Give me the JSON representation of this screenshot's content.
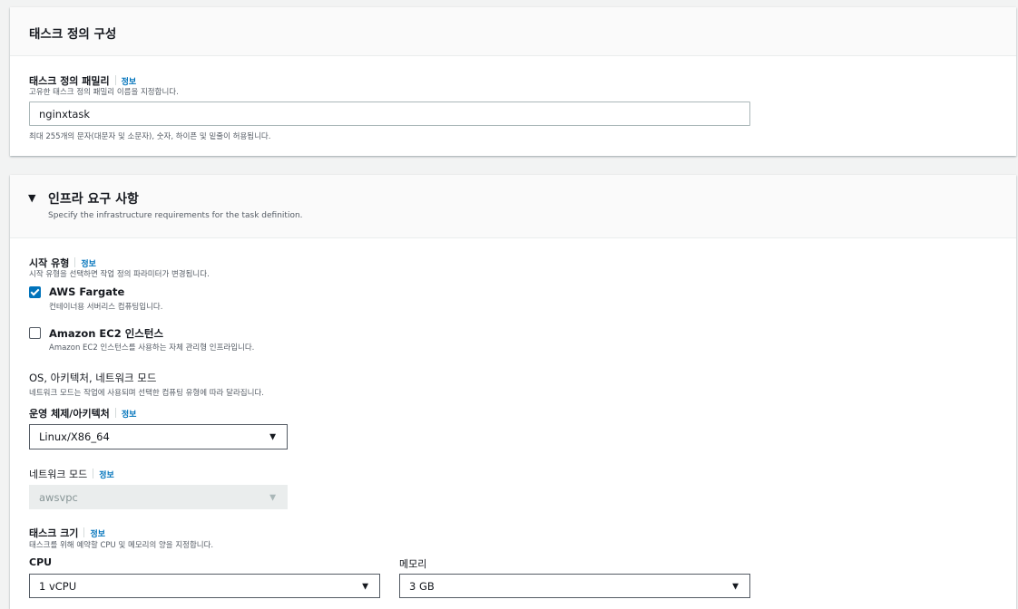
{
  "section1": {
    "title": "태스크 정의 구성",
    "family": {
      "label": "태스크 정의 패밀리",
      "info": "정보",
      "description": "고유한 태스크 정의 패밀리 이름을 지정합니다.",
      "value": "nginxtask",
      "constraint": "최대 255개의 문자(대문자 및 소문자), 숫자, 하이픈 및 밑줄이 허용됩니다."
    }
  },
  "section2": {
    "title": "인프라 요구 사항",
    "subtitle": "Specify the infrastructure requirements for the task definition.",
    "launch_type": {
      "label": "시작 유형",
      "info": "정보",
      "description": "시작 유형을 선택하면 작업 정의 파라미터가 변경됩니다.",
      "options": [
        {
          "label": "AWS Fargate",
          "description": "컨테이너용 서버리스 컴퓨팅입니다.",
          "checked": true
        },
        {
          "label": "Amazon EC2 인스턴스",
          "description": "Amazon EC2 인스턴스를 사용하는 자체 관리형 인프라입니다.",
          "checked": false
        }
      ]
    },
    "os_network": {
      "label": "OS, 아키텍처, 네트워크 모드",
      "description": "네트워크 모드는 작업에 사용되며 선택한 컴퓨팅 유형에 따라 달라집니다."
    },
    "os_arch": {
      "label": "운영 체제/아키텍처",
      "info": "정보",
      "value": "Linux/X86_64"
    },
    "network_mode": {
      "label": "네트워크 모드",
      "info": "정보",
      "value": "awsvpc"
    },
    "task_size": {
      "label": "태스크 크기",
      "info": "정보",
      "description": "태스크를 위해 예약할 CPU 및 메모리의 양을 지정합니다.",
      "cpu": {
        "label": "CPU",
        "value": "1 vCPU"
      },
      "memory": {
        "label": "메모리",
        "value": "3 GB"
      }
    }
  }
}
